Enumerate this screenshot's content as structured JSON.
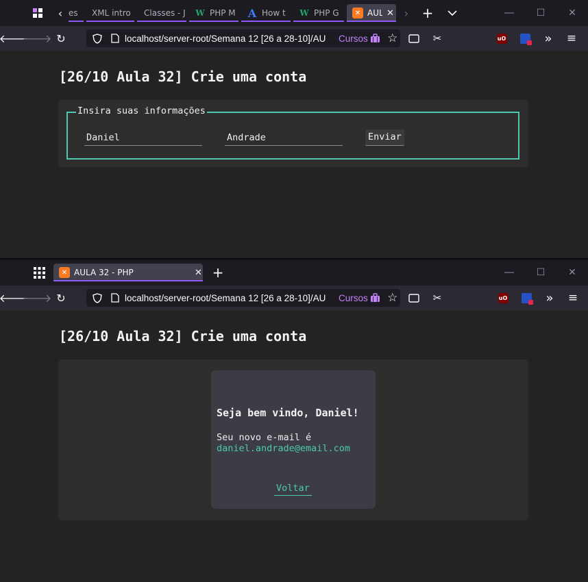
{
  "window1": {
    "tabs": [
      {
        "title": "es"
      },
      {
        "title": "XML intro"
      },
      {
        "title": "Classes - J"
      },
      {
        "title": "PHP M"
      },
      {
        "title": "How t"
      },
      {
        "title": "PHP G"
      },
      {
        "title": "AUL"
      }
    ],
    "url": "localhost/server-root/Semana 12 [26 a 28-10]/AU",
    "cursos_label": "Cursos"
  },
  "window2": {
    "tabs": [
      {
        "title": "AULA 32 - PHP"
      }
    ],
    "url": "localhost/server-root/Semana 12 [26 a 28-10]/AU",
    "cursos_label": "Cursos"
  },
  "page": {
    "heading": "[26/10 Aula 32] Crie uma conta",
    "form": {
      "legend": "Insira suas informações",
      "first_name": "Daniel",
      "last_name": "Andrade",
      "submit_label": "Enviar"
    },
    "result": {
      "greeting": "Seja bem vindo, Daniel!",
      "email_label": "Seu novo e-mail é",
      "email": "daniel.andrade@email.com",
      "back_label": "Voltar"
    }
  },
  "icons": {
    "ublock_text": "uO"
  },
  "colors": {
    "accent": "#9059ff",
    "teal": "#4ec9b0",
    "purple_text": "#c383f7"
  }
}
